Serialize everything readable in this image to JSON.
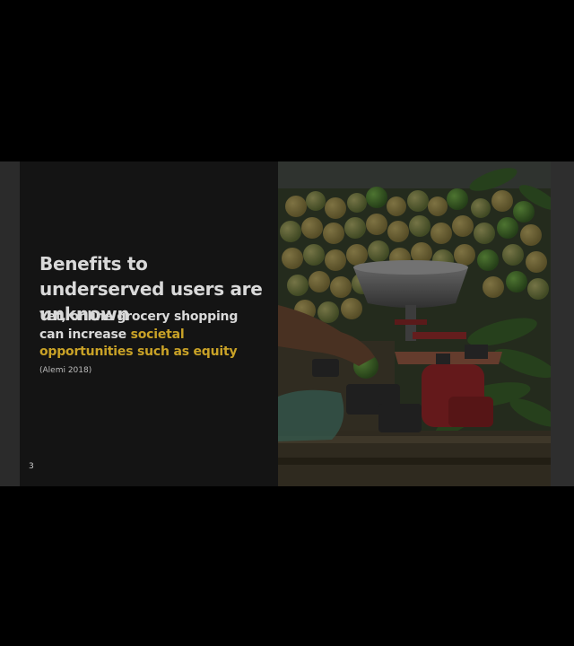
{
  "slide": {
    "title": "Benefits to underserved users are unknown",
    "body_prefix": "Yet, online grocery shopping can increase ",
    "body_highlight": "societal opportunities such as equity",
    "citation": "(Alemi 2018)",
    "page_number": "3",
    "image_icon": "market-produce-scale-photo"
  },
  "colors": {
    "background": "#000000",
    "text": "#d9d9d9",
    "accent": "#c9a227"
  }
}
